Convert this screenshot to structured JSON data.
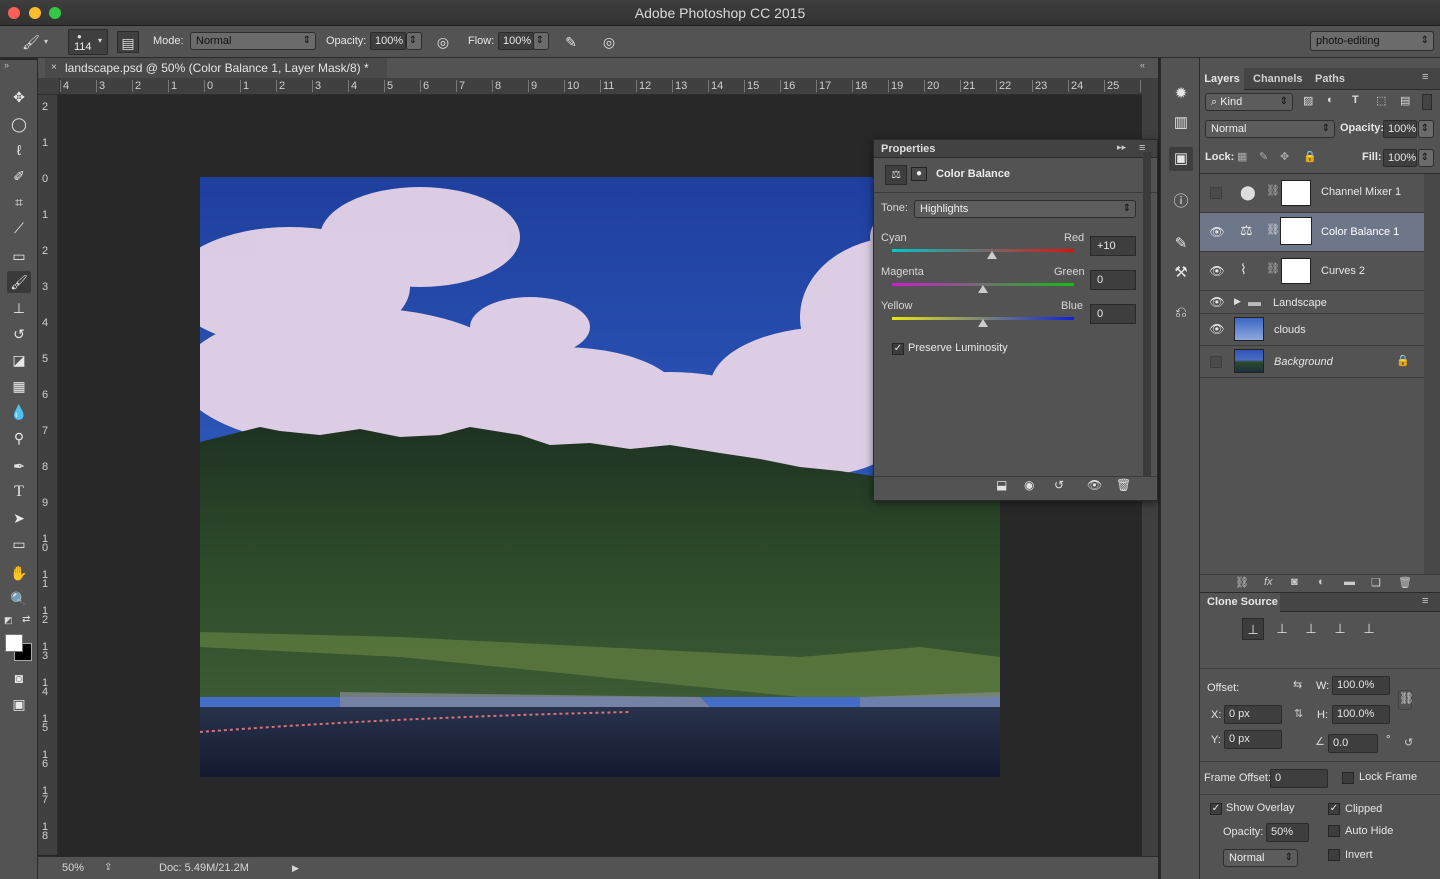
{
  "app": {
    "title": "Adobe Photoshop CC 2015"
  },
  "options_bar": {
    "brush_size": "114",
    "mode_label": "Mode:",
    "mode_value": "Normal",
    "opacity_label": "Opacity:",
    "opacity_value": "100%",
    "flow_label": "Flow:",
    "flow_value": "100%",
    "workspace": "photo-editing"
  },
  "document": {
    "tab_title": "landscape.psd @ 50% (Color Balance 1, Layer Mask/8) *",
    "zoom": "50%",
    "doc_size": "Doc: 5.49M/21.2M",
    "ruler_h": [
      "4",
      "3",
      "2",
      "1",
      "0",
      "1",
      "2",
      "3",
      "4",
      "5",
      "6",
      "7",
      "8",
      "9",
      "10",
      "11",
      "12",
      "13",
      "14",
      "15",
      "16",
      "17",
      "18",
      "19",
      "20",
      "21",
      "22",
      "23",
      "24",
      "25",
      "2"
    ],
    "ruler_v": [
      "2",
      "1",
      "0",
      "1",
      "2",
      "3",
      "4",
      "5",
      "6",
      "7",
      "8",
      "9",
      "10",
      "11",
      "12",
      "13",
      "14",
      "15",
      "16",
      "17",
      "18"
    ]
  },
  "properties": {
    "panel_title": "Properties",
    "adjustment_name": "Color Balance",
    "tone_label": "Tone:",
    "tone_value": "Highlights",
    "sliders": [
      {
        "left": "Cyan",
        "right": "Red",
        "value": "+10",
        "level": 0.55
      },
      {
        "left": "Magenta",
        "right": "Green",
        "value": "0",
        "level": 0.5
      },
      {
        "left": "Yellow",
        "right": "Blue",
        "value": "0",
        "level": 0.5
      }
    ],
    "preserve_luminosity": "Preserve Luminosity"
  },
  "layers_panel": {
    "tabs": [
      "Layers",
      "Channels",
      "Paths"
    ],
    "filter_kind": "Kind",
    "blend_mode": "Normal",
    "opacity_label": "Opacity:",
    "opacity_value": "100%",
    "lock_label": "Lock:",
    "fill_label": "Fill:",
    "fill_value": "100%",
    "layers": [
      {
        "name": "Channel Mixer 1",
        "visible": false,
        "icon": "channel-mixer-icon"
      },
      {
        "name": "Color Balance 1",
        "visible": true,
        "icon": "color-balance-icon",
        "selected": true
      },
      {
        "name": "Curves 2",
        "visible": true,
        "icon": "curves-icon"
      },
      {
        "name": "Landscape",
        "visible": true,
        "icon": "folder-icon",
        "group": true
      },
      {
        "name": "clouds",
        "visible": true,
        "icon": "image-thumb"
      },
      {
        "name": "Background",
        "visible": false,
        "icon": "image-thumb",
        "locked": true
      }
    ]
  },
  "clone_source": {
    "title": "Clone Source",
    "offset_label": "Offset:",
    "x_label": "X:",
    "x_value": "0 px",
    "y_label": "Y:",
    "y_value": "0 px",
    "w_label": "W:",
    "w_value": "100.0%",
    "h_label": "H:",
    "h_value": "100.0%",
    "angle_value": "0.0",
    "angle_unit": "°",
    "frame_offset_label": "Frame Offset:",
    "frame_offset_value": "0",
    "lock_frame": "Lock Frame",
    "show_overlay": "Show Overlay",
    "clipped": "Clipped",
    "overlay_opacity_label": "Opacity:",
    "overlay_opacity_value": "50%",
    "auto_hide": "Auto Hide",
    "invert": "Invert",
    "overlay_mode": "Normal"
  }
}
